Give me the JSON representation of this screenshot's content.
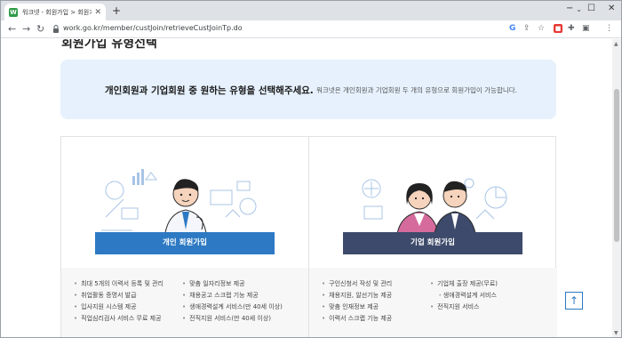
{
  "browser": {
    "tab_title": "워크넷 - 회원가입 > 회원가입 유형",
    "new_tab_label": "+",
    "url": "work.go.kr/member/custJoin/retrieveCustJoinTp.do"
  },
  "page": {
    "title": "회원가입 유형선택",
    "banner_main": "개인회원과 기업회원 중 원하는 유형을 선택해주세요.",
    "banner_sub": "워크넷은 개인회원과 기업회원 두 개의 유형으로 회원가입이 가능합니다."
  },
  "personal": {
    "button_label": "개인 회원가입",
    "features_col1": [
      "최대 5개의 이력서 등록 및 관리",
      "취업활동 증명서 발급",
      "입사지원 시스템 제공",
      "직업심리검사 서비스 무료 제공"
    ],
    "features_col2": [
      "맞춤 일자리정보 제공",
      "채용공고 스크랩 기능 제공",
      "생애경력설계 서비스(만 40세 이상)",
      "전직지원 서비스(만 40세 이상)"
    ]
  },
  "company": {
    "button_label": "기업 회원가입",
    "features_col1": [
      "구인신청서 작성 및 관리",
      "채용지원, 알선기능 제공",
      "맞춤 인재정보 제공",
      "이력서 스크랩 기능 제공"
    ],
    "features_col2": [
      "기업체 출장 제공(무료)",
      "- 생애경력설계 서비스",
      "",
      "전직지원 서비스"
    ]
  },
  "icons": {
    "top_button": "arrow-up-icon"
  }
}
